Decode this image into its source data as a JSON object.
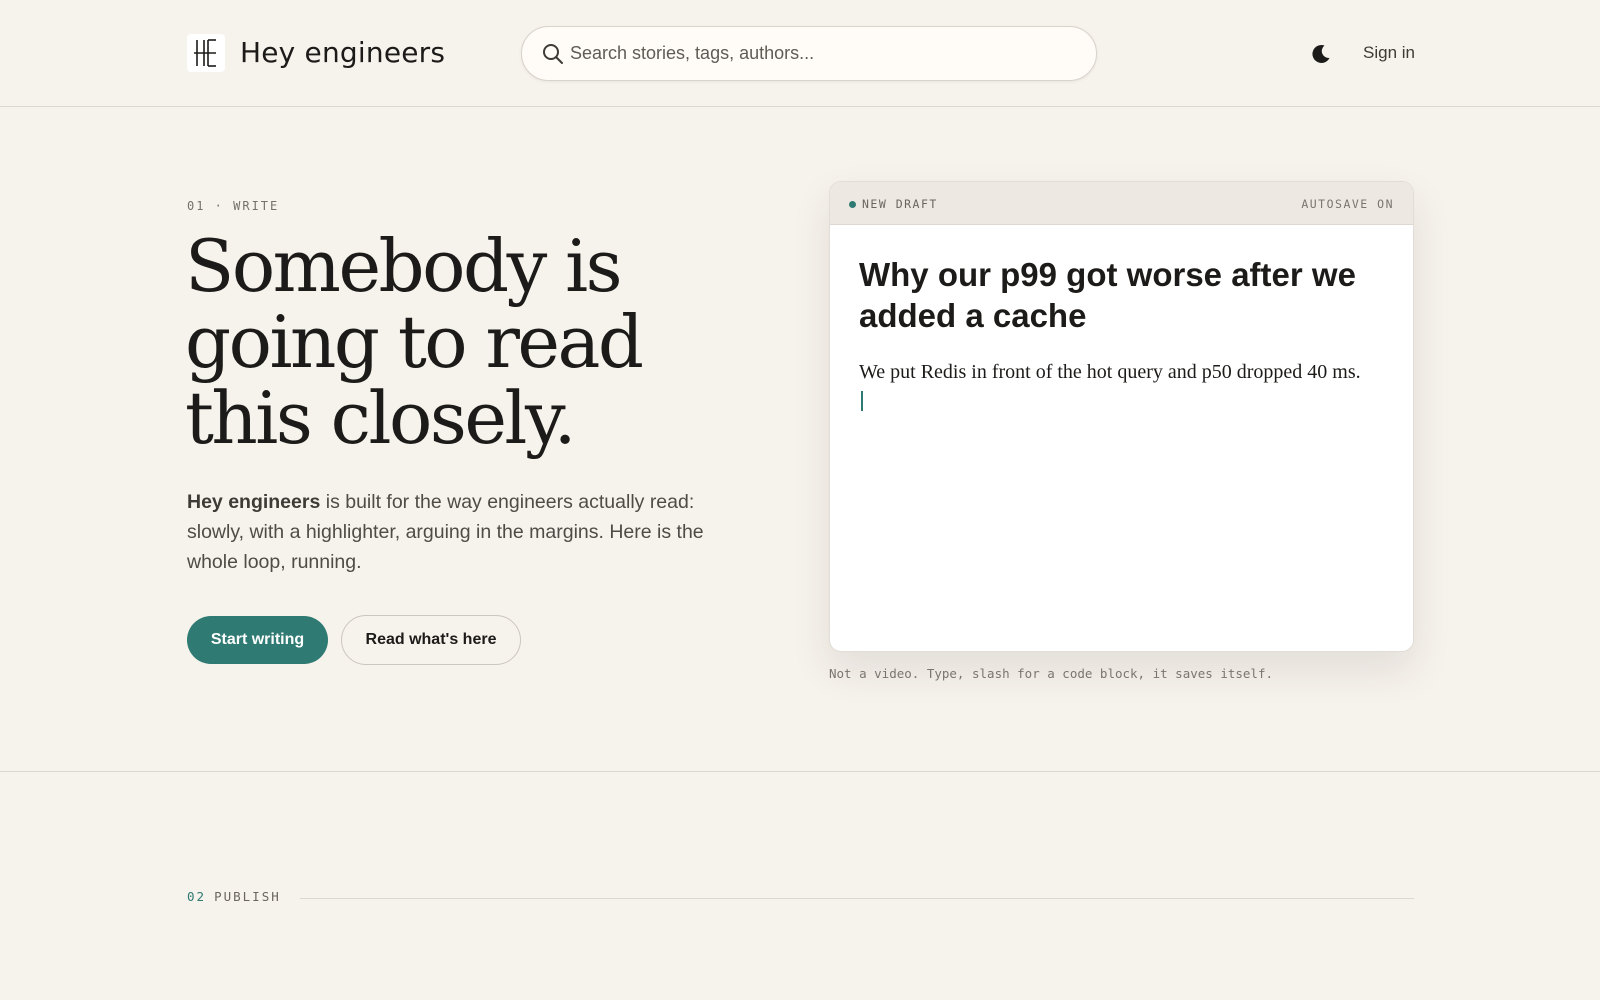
{
  "header": {
    "brand": "Hey engineers",
    "search_placeholder": "Search stories, tags, authors...",
    "sign_in": "Sign in"
  },
  "hero": {
    "section_label": "01 · WRITE",
    "title": "Somebody is going to read this closely.",
    "desc_bold": "Hey engineers",
    "desc_rest": " is built for the way engineers actually read: slowly, with a highlighter, arguing in the margins. Here is the whole loop, running.",
    "primary_button": "Start writing",
    "secondary_button": "Read what's here"
  },
  "editor": {
    "status": "NEW DRAFT",
    "autosave": "AUTOSAVE ON",
    "draft_title": "Why our p99 got worse after we added a cache",
    "draft_body": "We put Redis in front of the hot query and p50 dropped 40 ms.",
    "note": "Not a video. Type, slash for a code block, it saves itself."
  },
  "next_section": {
    "number": "02",
    "label": "PUBLISH"
  },
  "colors": {
    "background": "#f6f2ec",
    "accent": "#2f7a73",
    "text": "#1c1b19"
  },
  "icons": {
    "logo": "he-monogram-icon",
    "search": "search-icon",
    "theme": "moon-icon"
  }
}
